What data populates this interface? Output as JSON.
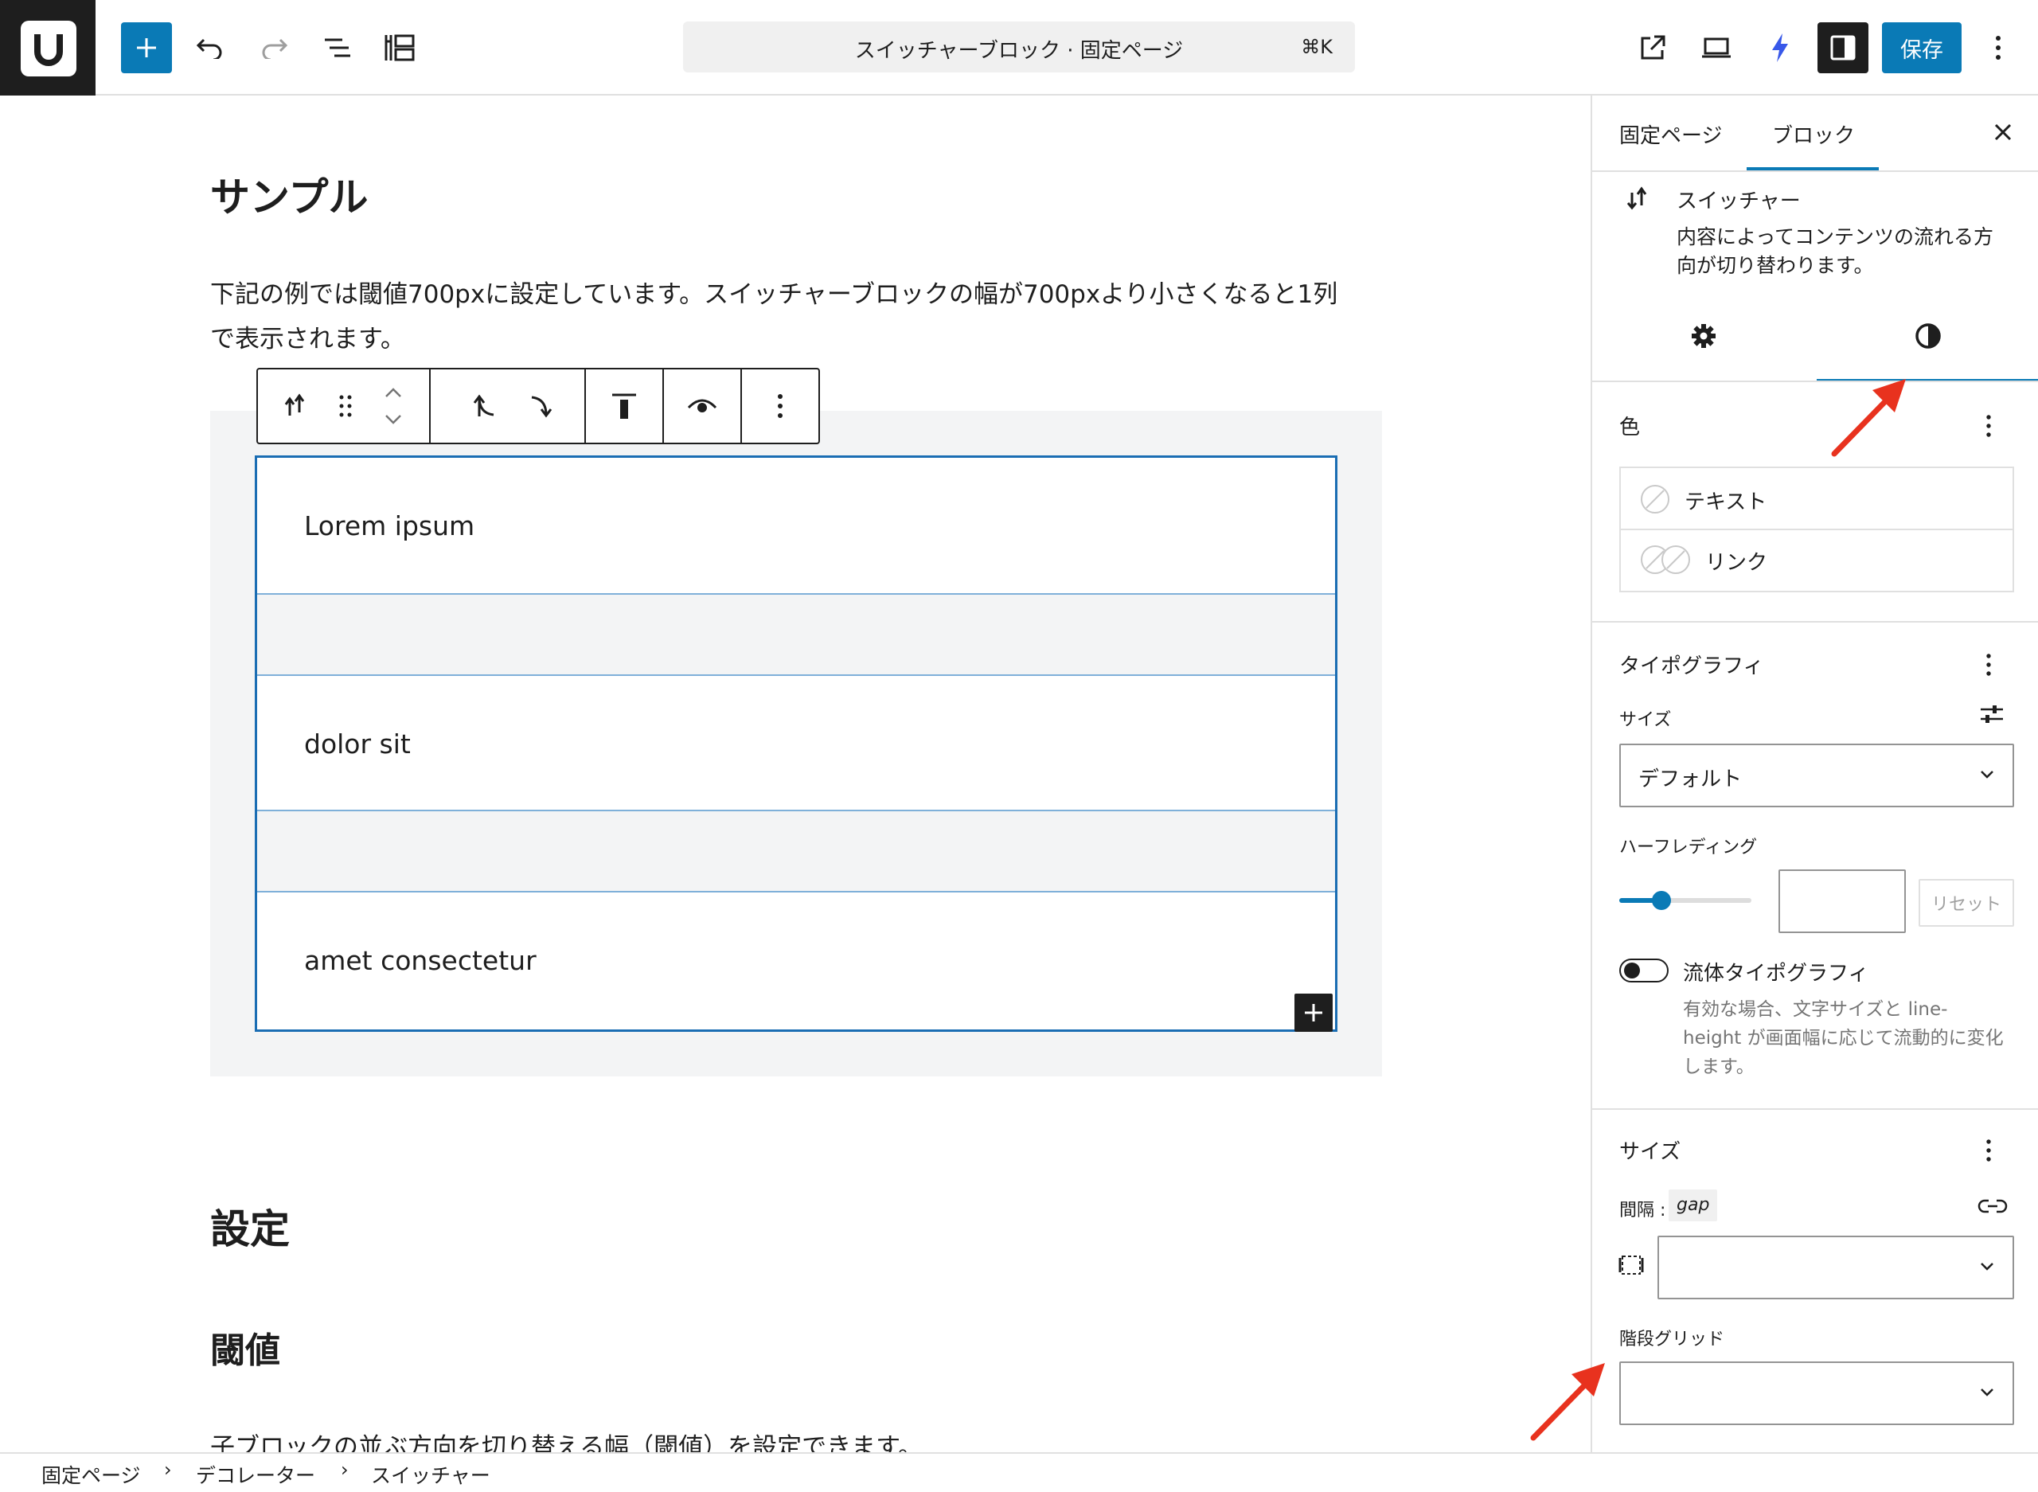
{
  "toolbar": {
    "logo_letter": "U",
    "command_title": "スイッチャーブロック · 固定ページ",
    "command_shortcut": "⌘K",
    "save_label": "保存"
  },
  "content": {
    "heading_sample": "サンプル",
    "intro_line1": "下記の例では閾値700pxに設定しています。スイッチャーブロックの幅が700pxより小さくなると1列",
    "intro_line2": "で表示されます。",
    "switcher_items": [
      "Lorem ipsum",
      "dolor sit",
      "amet consectetur"
    ],
    "heading_settings": "設定",
    "heading_threshold": "閾値",
    "threshold_desc": "子ブロックの並ぶ方向を切り替える幅（閾値）を設定できます。"
  },
  "sidebar": {
    "tabs": [
      "固定ページ",
      "ブロック"
    ],
    "active_tab": "ブロック",
    "block_name": "スイッチャー",
    "block_desc_line1": "内容によってコンテンツの流れる方",
    "block_desc_line2": "向が切り替わります。",
    "color": {
      "title": "色",
      "items": [
        "テキスト",
        "リンク"
      ]
    },
    "typography": {
      "title": "タイポグラフィ",
      "size_label": "サイズ",
      "size_value": "デフォルト",
      "half_leading_label": "ハーフレディング",
      "half_leading_slider": 0.32,
      "reset_label": "リセット",
      "fluid_label": "流体タイポグラフィ",
      "fluid_help_line1": "有効な場合、文字サイズと line-",
      "fluid_help_line2": "height が画面幅に応じて流動的に変化",
      "fluid_help_line3": "します。"
    },
    "size": {
      "title": "サイズ",
      "gap_label": "間隔 :",
      "gap_badge": "gap",
      "stair_grid_label": "階段グリッド"
    }
  },
  "breadcrumb": [
    "固定ページ",
    "デコレーター",
    "スイッチャー"
  ],
  "colors": {
    "accent": "#0a7ab6",
    "selection_border": "#1a6db3",
    "annotation_arrow": "#e8321e"
  }
}
